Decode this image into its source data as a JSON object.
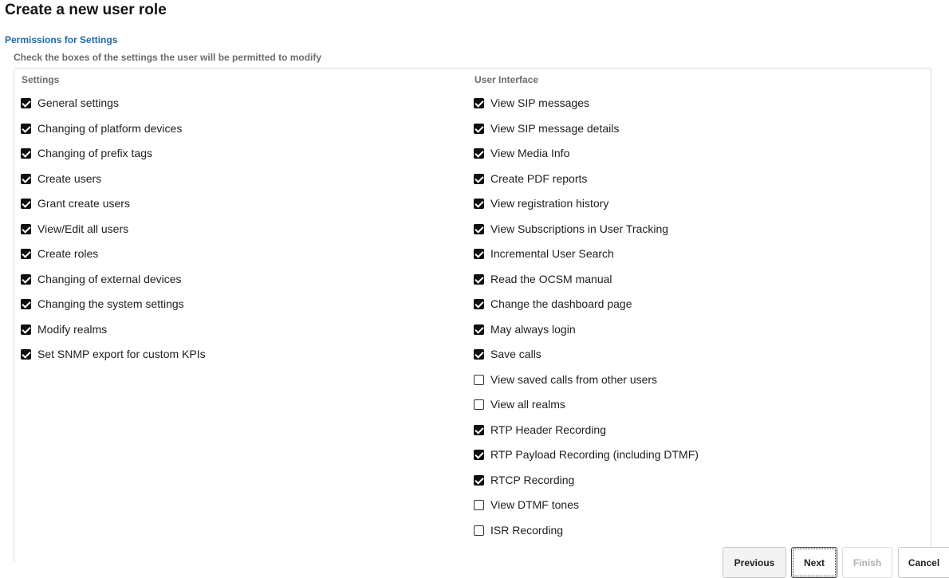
{
  "page": {
    "title": "Create a new user role",
    "section_title": "Permissions for Settings",
    "section_description": "Check the boxes of the settings the user will be permitted to modify"
  },
  "settings": {
    "header": "Settings",
    "items": [
      {
        "label": "General settings",
        "checked": true
      },
      {
        "label": "Changing of platform devices",
        "checked": true
      },
      {
        "label": "Changing of prefix tags",
        "checked": true
      },
      {
        "label": "Create users",
        "checked": true
      },
      {
        "label": "Grant create users",
        "checked": true
      },
      {
        "label": "View/Edit all users",
        "checked": true
      },
      {
        "label": "Create roles",
        "checked": true
      },
      {
        "label": "Changing of external devices",
        "checked": true
      },
      {
        "label": "Changing the system settings",
        "checked": true
      },
      {
        "label": "Modify realms",
        "checked": true
      },
      {
        "label": "Set SNMP export for custom KPIs",
        "checked": true
      }
    ]
  },
  "user_interface": {
    "header": "User Interface",
    "items": [
      {
        "label": "View SIP messages",
        "checked": true
      },
      {
        "label": "View SIP message details",
        "checked": true
      },
      {
        "label": "View Media Info",
        "checked": true
      },
      {
        "label": "Create PDF reports",
        "checked": true
      },
      {
        "label": "View registration history",
        "checked": true
      },
      {
        "label": "View Subscriptions in User Tracking",
        "checked": true
      },
      {
        "label": "Incremental User Search",
        "checked": true
      },
      {
        "label": "Read the OCSM manual",
        "checked": true
      },
      {
        "label": "Change the dashboard page",
        "checked": true
      },
      {
        "label": "May always login",
        "checked": true
      },
      {
        "label": "Save calls",
        "checked": true
      },
      {
        "label": "View saved calls from other users",
        "checked": false
      },
      {
        "label": "View all realms",
        "checked": false
      },
      {
        "label": "RTP Header Recording",
        "checked": true
      },
      {
        "label": "RTP Payload Recording (including DTMF)",
        "checked": true
      },
      {
        "label": "RTCP Recording",
        "checked": true
      },
      {
        "label": "View DTMF tones",
        "checked": false
      },
      {
        "label": "ISR Recording",
        "checked": false
      }
    ]
  },
  "buttons": {
    "previous": "Previous",
    "next": "Next",
    "finish": "Finish",
    "cancel": "Cancel",
    "finish_disabled": true
  }
}
